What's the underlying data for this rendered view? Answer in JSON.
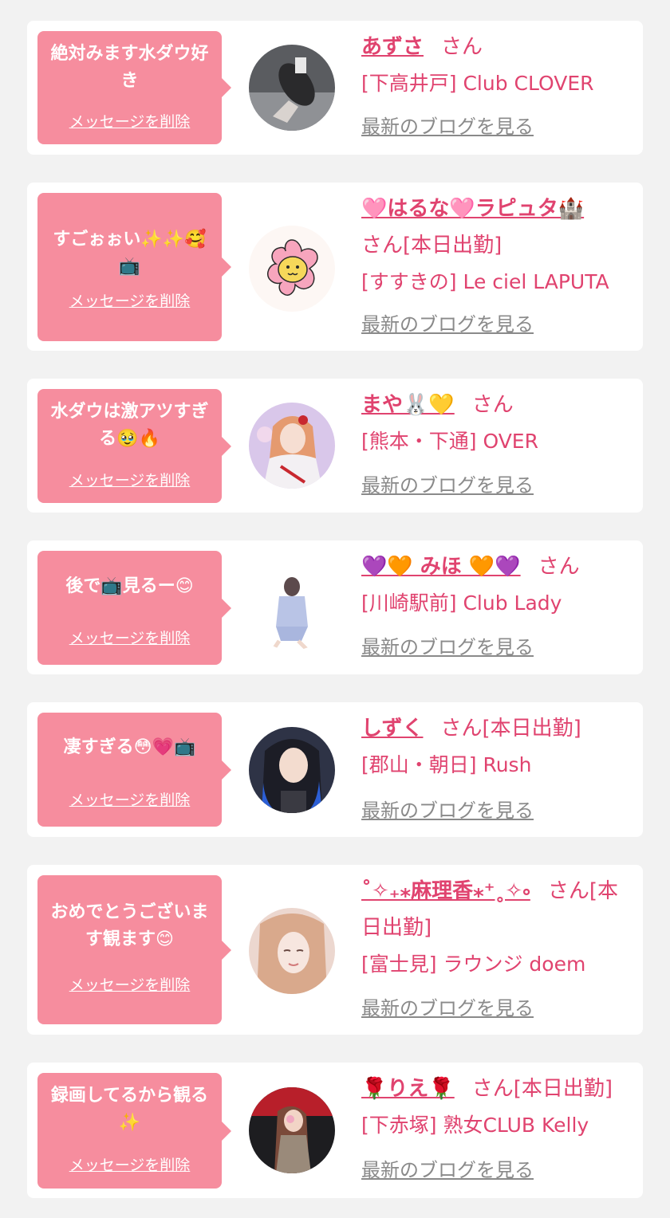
{
  "delete_label": "メッセージを削除",
  "blog_label": "最新のブログを見る",
  "honorific": "さん",
  "colors": {
    "background": "#f2f2f2",
    "bubble": "#f68d9e",
    "name": "#e0436f",
    "blog_link": "#8a8a8a"
  },
  "cards": [
    {
      "message": "絶対みます水ダウ好き",
      "name": "あずさ",
      "suffix": "さん",
      "shop": "[下高井戸] Club CLOVER"
    },
    {
      "message": "すごぉぉい✨✨🥰📺",
      "name": "🩷はるな🩷ラピュタ🏰",
      "suffix": "さん[本日出勤]",
      "shop": "[すすきの] Le ciel LAPUTA"
    },
    {
      "message": "水ダウは激アツすぎる🥹🔥",
      "name": "まや🐰💛",
      "suffix": "さん",
      "shop": "[熊本・下通] OVER"
    },
    {
      "message": "後で📺見るー😊",
      "name": "💜🧡 みほ 🧡💜",
      "suffix": "さん",
      "shop": "[川崎駅前] Club Lady"
    },
    {
      "message": "凄すぎる😳💗📺",
      "name": "しずく",
      "suffix": "さん[本日出勤]",
      "shop": "[郡山・朝日] Rush"
    },
    {
      "message": "おめでとうございます観ます😊",
      "name": "˚✧₊⁎麻理香⁎⁺˳✧༚",
      "suffix": "さん[本日出勤]",
      "shop": "[富士見] ラウンジ doem"
    },
    {
      "message": "録画してるから観る✨",
      "name": "🌹りえ🌹",
      "suffix": "さん[本日出勤]",
      "shop": "[下赤塚] 熟女CLUB Kelly"
    }
  ]
}
